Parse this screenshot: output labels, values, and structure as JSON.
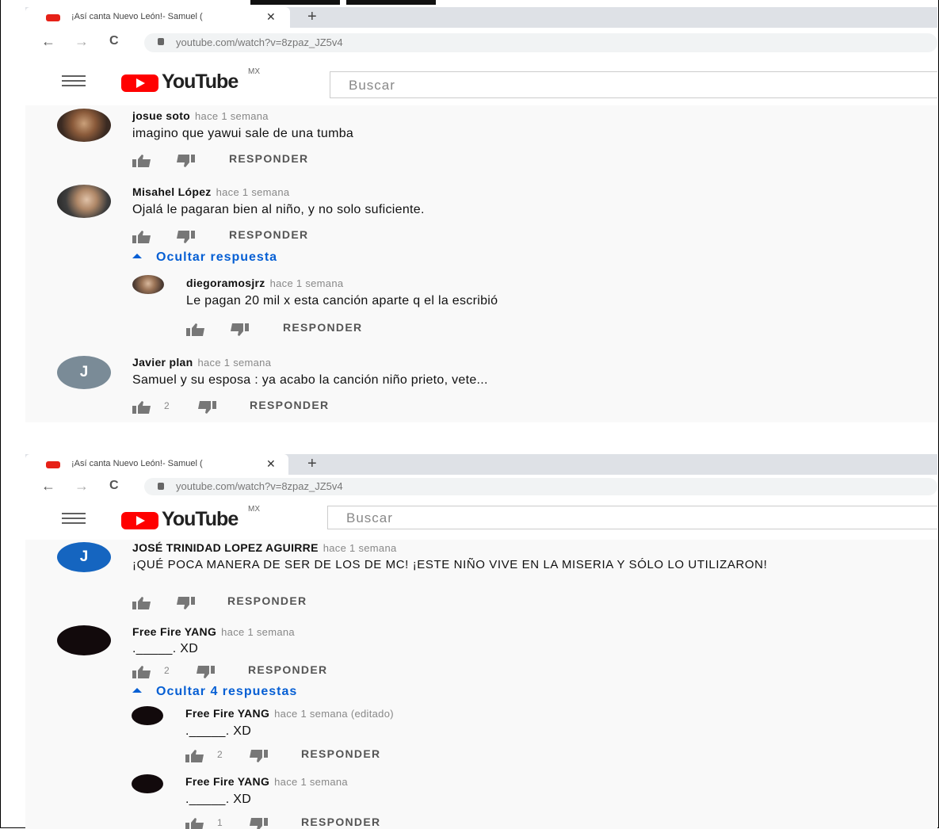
{
  "browser": {
    "tab_title": "¡Así canta Nuevo León!- Samuel (",
    "tab_close": "✕",
    "new_tab": "+",
    "url": "youtube.com/watch?v=8zpaz_JZ5v4",
    "back": "←",
    "forward": "→",
    "reload": "C"
  },
  "youtube": {
    "logo_text": "YouTube",
    "country": "MX",
    "search_placeholder": "Buscar"
  },
  "colors": {
    "link_blue": "#065fd4",
    "logo_red": "#ff0000",
    "avatar_grey": "#7a8b97",
    "avatar_blue": "#1565c0"
  },
  "labels": {
    "reply": "RESPONDER"
  },
  "top_panel": {
    "comments": [
      {
        "author": "josue soto",
        "time": "hace 1 semana",
        "text": "imagino que yawui sale de una tumba",
        "likes": ""
      },
      {
        "author": "Misahel López",
        "time": "hace 1 semana",
        "text": "Ojalá le pagaran bien al niño, y no solo suficiente.",
        "likes": "",
        "toggle": "Ocultar respuesta"
      },
      {
        "author": "diegoramosjrz",
        "time": "hace 1 semana",
        "text": "Le pagan 20 mil x esta canción aparte q el la escribió",
        "likes": ""
      },
      {
        "author": "Javier plan",
        "time": "hace 1 semana",
        "text": "Samuel y su esposa : ya acabo la canción niño prieto, vete...",
        "likes": "2",
        "avatar_letter": "J"
      }
    ]
  },
  "bottom_panel": {
    "comments": [
      {
        "author": "JOSÉ TRINIDAD LOPEZ AGUIRRE",
        "time": "hace 1 semana",
        "text": "¡QUÉ POCA MANERA DE SER DE LOS DE MC! ¡ESTE NIÑO VIVE EN LA MISERIA Y SÓLO LO UTILIZARON!",
        "likes": "",
        "avatar_letter": "J"
      },
      {
        "author": "Free Fire YANG",
        "time": "hace 1 semana",
        "text": "._____. XD",
        "likes": "2",
        "toggle": "Ocultar 4 respuestas"
      },
      {
        "author": "Free Fire YANG",
        "time": "hace 1 semana (editado)",
        "text": "._____. XD",
        "likes": "2"
      },
      {
        "author": "Free Fire YANG",
        "time": "hace 1 semana",
        "text": "._____. XD",
        "likes": "1"
      }
    ]
  }
}
